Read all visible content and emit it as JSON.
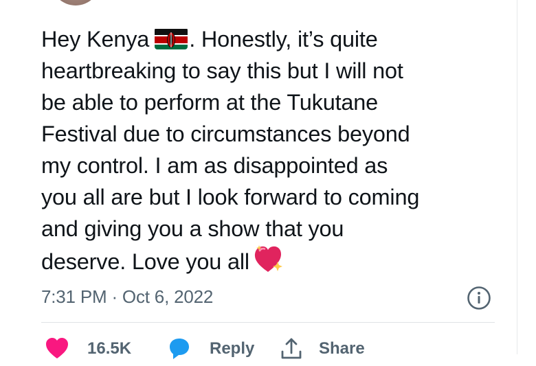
{
  "tweet": {
    "lines": [
      "Hey Kenya",
      ". Honestly, it’s quite",
      "heartbreaking to say this but I will not",
      "be able to perform at the Tukutane",
      "Festival due to circumstances beyond",
      "my control. I am as disappointed as",
      "you all are but I look forward to coming",
      "and giving you a show that you",
      "deserve. Love you all"
    ],
    "emojis": [
      "kenya-flag",
      "sparkling-heart"
    ],
    "timestamp": "7:31 PM · Oct 6, 2022"
  },
  "actions": {
    "like_count": "16.5K",
    "reply_label": "Reply",
    "share_label": "Share"
  },
  "colors": {
    "text": "#0f1419",
    "muted": "#536471",
    "like": "#f91880",
    "reply": "#1d9bf0",
    "divider": "#dfe3e6"
  },
  "icons": [
    "info-icon",
    "heart-icon",
    "reply-icon",
    "share-icon"
  ]
}
